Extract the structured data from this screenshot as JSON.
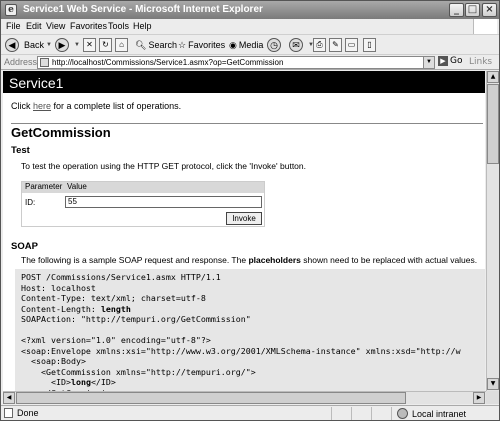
{
  "window": {
    "title": "Service1 Web Service - Microsoft Internet Explorer",
    "app_icon": "ie-icon",
    "controls": {
      "minimize": "_",
      "maximize": "□",
      "close": "×"
    }
  },
  "menu": [
    "File",
    "Edit",
    "View",
    "Favorites",
    "Tools",
    "Help"
  ],
  "toolbar": {
    "back": "Back",
    "search": "Search",
    "favorites": "Favorites",
    "media": "Media"
  },
  "address": {
    "label": "Address",
    "url": "http://localhost/Commissions/Service1.asmx?op=GetCommission",
    "go": "Go",
    "links": "Links"
  },
  "page": {
    "banner": "Service1",
    "intro_prefix": "Click ",
    "intro_link": "here",
    "intro_suffix": " for a complete list of operations.",
    "heading": "GetCommission",
    "test": {
      "heading": "Test",
      "text": "To test the operation using the HTTP GET protocol, click the 'Invoke' button.",
      "col_parameter": "Parameter",
      "col_value": "Value",
      "param_label": "ID:",
      "param_value": "55",
      "invoke": "Invoke"
    },
    "soap": {
      "heading": "SOAP",
      "text_prefix": "The following is a sample SOAP request and response. The ",
      "text_bold": "placeholders",
      "text_suffix": " shown need to be replaced with actual values.",
      "code_lines": [
        "POST /Commissions/Service1.asmx HTTP/1.1",
        "Host: localhost",
        "Content-Type: text/xml; charset=utf-8",
        "Content-Length: length",
        "SOAPAction: \"http://tempuri.org/GetCommission\"",
        "",
        "<?xml version=\"1.0\" encoding=\"utf-8\"?>",
        "<soap:Envelope xmlns:xsi=\"http://www.w3.org/2001/XMLSchema-instance\" xmlns:xsd=\"http://w",
        "  <soap:Body>",
        "    <GetCommission xmlns=\"http://tempuri.org/\">",
        "      <ID>long</ID>",
        "    </GetCommission>"
      ]
    }
  },
  "status": {
    "left": "Done",
    "zone": "Local intranet"
  }
}
